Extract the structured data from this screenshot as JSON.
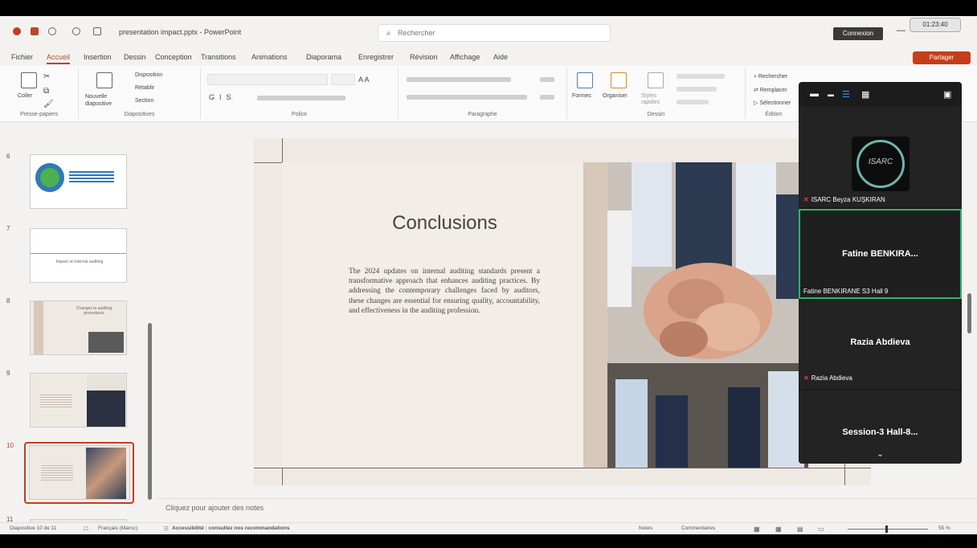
{
  "window": {
    "doc_title": "presentation impact.pptx - PowerPoint",
    "search_placeholder": "Rechercher",
    "connexion": "Connexion",
    "timer": "01:23:40"
  },
  "menu": {
    "tabs": [
      "Fichier",
      "Accueil",
      "Insertion",
      "Dessin",
      "Conception",
      "Transitions",
      "Animations",
      "Diaporama",
      "Enregistrer",
      "Révision",
      "Affichage",
      "Aide"
    ],
    "active": "Accueil",
    "share": "Partager"
  },
  "ribbon": {
    "clipboard": {
      "paste": "Coller",
      "label": "Presse-papiers"
    },
    "slides": {
      "new_slide": "Nouvelle diapositive",
      "layout": "Disposition",
      "reset": "Rétablir",
      "section": "Section",
      "label": "Diapositives"
    },
    "font": {
      "label": "Police"
    },
    "paragraph": {
      "label": "Paragraphe"
    },
    "drawing": {
      "shapes": "Formes",
      "arrange": "Organiser",
      "quick_styles": "Styles rapides",
      "label": "Dessin"
    },
    "editing": {
      "find": "Rechercher",
      "replace": "Remplacer",
      "select": "Sélectionner",
      "label": "Édition"
    }
  },
  "slides_panel": {
    "numbers": [
      "6",
      "7",
      "8",
      "9",
      "10",
      "11"
    ],
    "thumb7_title": "Impact on internal auditing",
    "thumb8_title": "Changes to auditing procedures"
  },
  "slide": {
    "title": "Conclusions",
    "body": "The 2024 updates on internal auditing standards present a transformative approach that enhances auditing practices. By addressing the contemporary challenges faced by auditors, these changes are essential for ensuring quality, accountability, and effectiveness in the auditing profession."
  },
  "notes_placeholder": "Cliquez pour ajouter des notes",
  "status": {
    "slide_count": "Diapositive 10 de 11",
    "language": "Français (Maroc)",
    "accessibility": "Accessibilité : consultez nos recommandations",
    "notes": "Notes",
    "comments": "Commentaires",
    "zoom": "55 %"
  },
  "zoom": {
    "participants": [
      {
        "label": "ISARC Beyza KUŞKIRAN"
      },
      {
        "big_name": "Fatine BENKIRA...",
        "label": "Fatine BENKIRANE S3 Hall 9"
      },
      {
        "big_name": "Razia Abdieva",
        "label": "Razia Abdieva"
      },
      {
        "big_name": "Session-3  Hall-8..."
      }
    ],
    "logo_text": "ISARC"
  },
  "colors": {
    "accent": "#b7472a",
    "share": "#c43e1c",
    "active_speaker": "#2fb36a"
  }
}
